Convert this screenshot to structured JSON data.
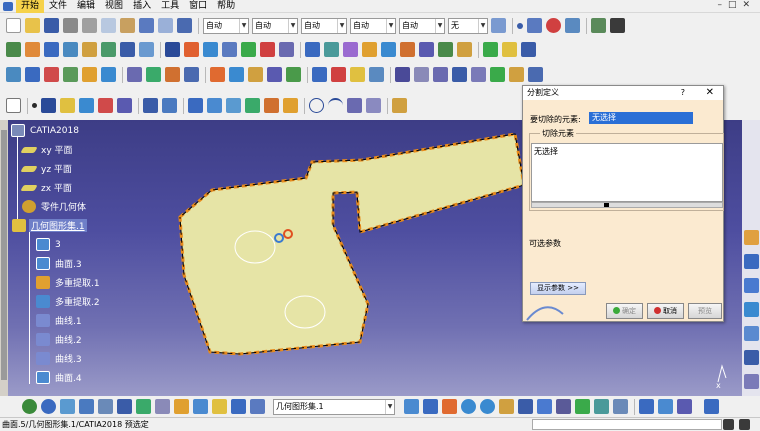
{
  "menu": {
    "items": [
      "开始",
      "文件",
      "编辑",
      "视图",
      "插入",
      "工具",
      "窗口",
      "帮助"
    ]
  },
  "toolbar": {
    "combos": [
      "自动",
      "自动",
      "自动",
      "自动",
      "自动",
      "无"
    ]
  },
  "tree": {
    "root": "CATIA2018",
    "items": [
      {
        "label": "xy 平面",
        "hl": false
      },
      {
        "label": "yz 平面",
        "hl": false
      },
      {
        "label": "zx 平面",
        "hl": false
      },
      {
        "label": "零件几何体",
        "hl": false
      },
      {
        "label": "几何图形集.1",
        "hl": true
      },
      {
        "label": "3",
        "hl": false
      },
      {
        "label": "曲面.3",
        "hl": false
      },
      {
        "label": "多重提取.1",
        "hl": false
      },
      {
        "label": "多重提取.2",
        "hl": false
      },
      {
        "label": "曲线.1",
        "hl": false
      },
      {
        "label": "曲线.2",
        "hl": false
      },
      {
        "label": "曲线.3",
        "hl": false
      },
      {
        "label": "曲面.4",
        "hl": false
      }
    ]
  },
  "dialog": {
    "title": "分割定义",
    "help": "?",
    "close": "✕",
    "cut_label": "要切除的元素:",
    "cut_value": "无选择",
    "cut_elements_legend": "切除元素",
    "cut_elements_value": "无选择",
    "optional_params": "可选参数",
    "show_params_button": "显示参数 >>",
    "ok_label": "确定",
    "cancel_label": "取消",
    "preview_label": "预览"
  },
  "bottom": {
    "combo_value": "几何图形集.1"
  },
  "status": {
    "text": "曲面.5/几何图形集.1/CATIA2018 预选定"
  },
  "colors": {
    "viewport_top": "#3d3d86",
    "viewport_bottom": "#9a9ac8",
    "part_fill": "#e6e4a6",
    "part_edge": "#e88a1a",
    "dialog_bg": "#fbead0",
    "selection": "#2a6fd6"
  }
}
